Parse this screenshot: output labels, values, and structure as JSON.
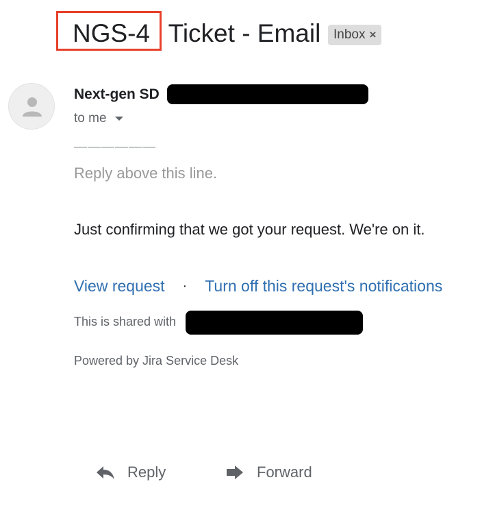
{
  "email": {
    "subject_key": "NGS-4",
    "subject_rest": " Ticket - Email",
    "inbox_label": "Inbox",
    "inbox_close": "×",
    "sender_name": "Next-gen SD",
    "recipient_label": "to me",
    "separator": "——————",
    "reply_above": "Reply above this line.",
    "body": "Just confirming that we got your request. We're on it.",
    "links": {
      "view_request": "View request",
      "separator_dot": "·",
      "turn_off": "Turn off this request's notifications"
    },
    "shared_prefix": "This is shared with",
    "powered_by": "Powered by Jira Service Desk"
  },
  "actions": {
    "reply": "Reply",
    "forward": "Forward"
  },
  "icons": {
    "avatar": "person-icon",
    "recipient_toggle": "chevron-down-icon",
    "reply": "reply-arrow-icon",
    "forward": "forward-arrow-icon"
  },
  "colors": {
    "highlight": "#e8402a",
    "link": "#2f6fb0",
    "badge": "#dddddd"
  }
}
